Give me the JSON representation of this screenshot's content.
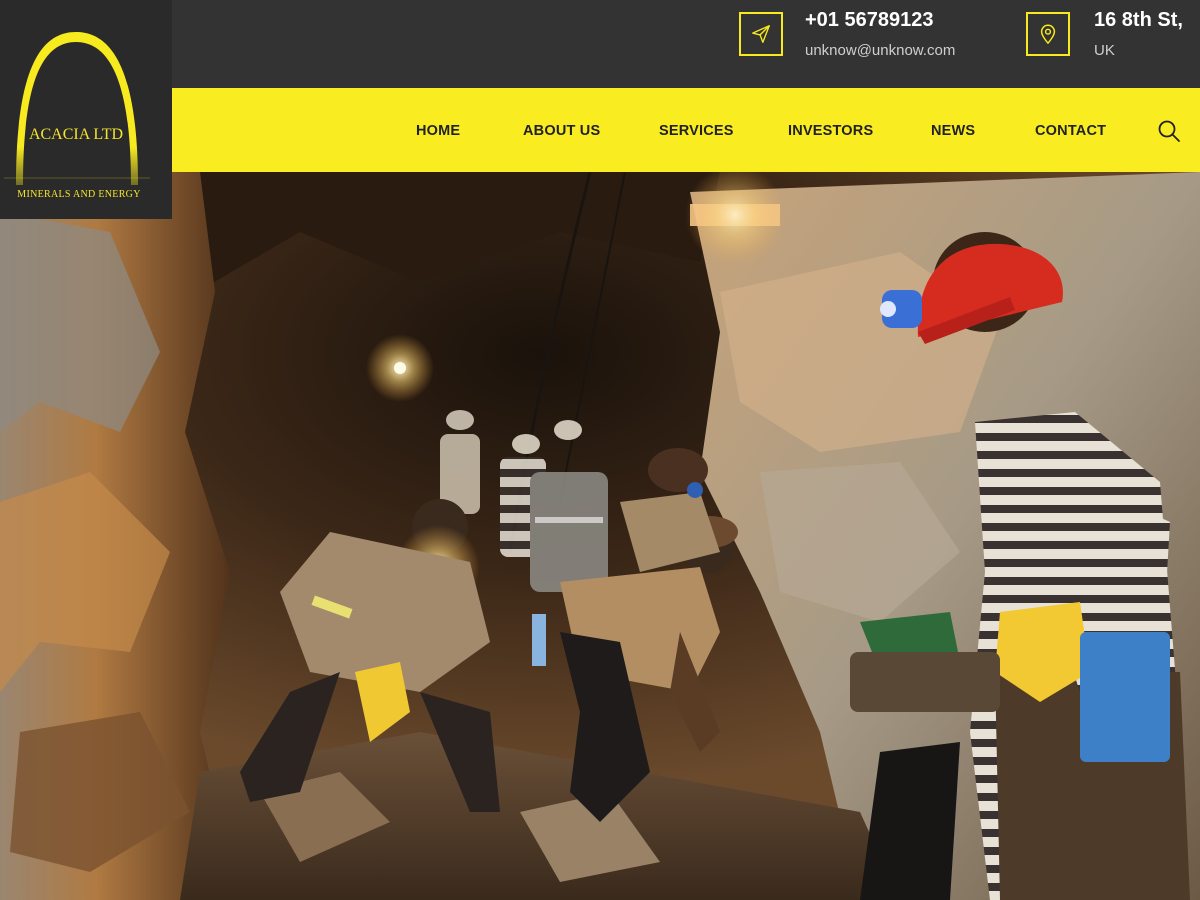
{
  "brand": {
    "name": "ACACIA LTD",
    "tagline": "MINERALS AND ENERGY",
    "accent_color": "#f9ec21",
    "dark_color": "#333333"
  },
  "contact": {
    "phone": "+01 56789123",
    "email": "unknow@unknow.com",
    "address_line1": "16 8th St,",
    "address_line2": "UK",
    "phone_icon": "paper-plane-icon",
    "address_icon": "map-pin-icon"
  },
  "nav": {
    "items": [
      {
        "label": "HOME"
      },
      {
        "label": "ABOUT US"
      },
      {
        "label": "SERVICES"
      },
      {
        "label": "INVESTORS"
      },
      {
        "label": "NEWS"
      },
      {
        "label": "CONTACT"
      }
    ],
    "search_icon": "search-icon"
  },
  "hero": {
    "image": "underground-mine-workers-photo"
  }
}
